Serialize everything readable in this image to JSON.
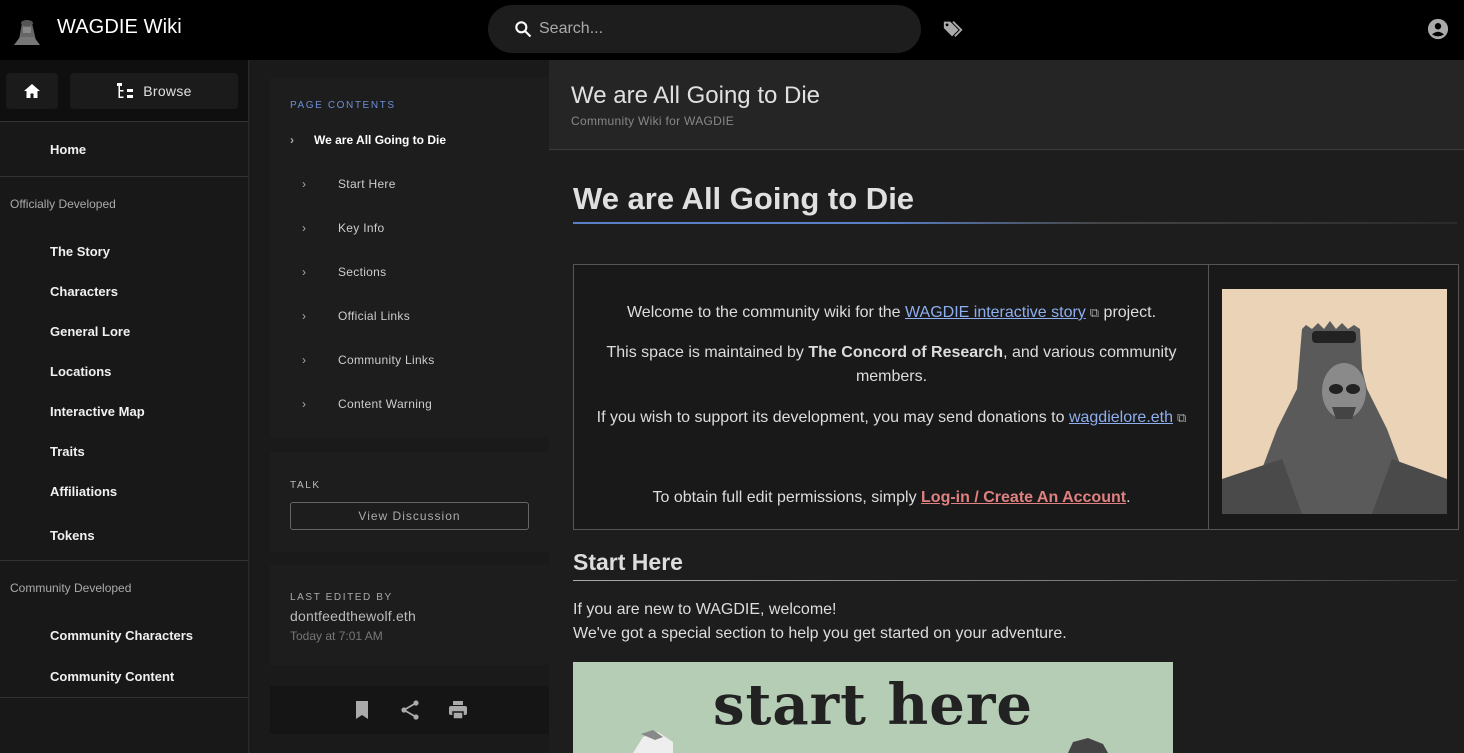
{
  "topbar": {
    "site_title": "WAGDIE Wiki",
    "search_placeholder": "Search...",
    "icons": [
      "logo",
      "search-icon",
      "tags-icon",
      "account-icon"
    ]
  },
  "leftnav": {
    "home_icon": "home-icon",
    "browse_label": "Browse",
    "home_item": "Home",
    "sections": [
      {
        "header": "Officially Developed",
        "items": [
          "The Story",
          "Characters",
          "General Lore",
          "Locations",
          "Interactive Map",
          "Traits",
          "Affiliations",
          "Tokens"
        ]
      },
      {
        "header": "Community Developed",
        "items": [
          "Community Characters",
          "Community Content"
        ]
      }
    ]
  },
  "toc": {
    "header": "PAGE CONTENTS",
    "top": "We are All Going to Die",
    "items": [
      "Start Here",
      "Key Info",
      "Sections",
      "Official Links",
      "Community Links",
      "Content Warning"
    ]
  },
  "talk": {
    "label": "TALK",
    "button": "View Discussion"
  },
  "last_edited": {
    "label": "LAST EDITED BY",
    "user": "dontfeedthewolf.eth",
    "time": "Today at 7:01 AM"
  },
  "actions": [
    "bookmark-icon",
    "share-icon",
    "print-icon"
  ],
  "page_header": {
    "title": "We are All Going to Die",
    "subtitle": "Community Wiki for WAGDIE"
  },
  "content": {
    "h1": "We are All Going to Die",
    "welcome": {
      "p1_before": "Welcome to the community wiki for the ",
      "p1_link": "WAGDIE interactive story",
      "p1_after": " project.",
      "p2_before": "This space is maintained by ",
      "p2_bold": "The Concord of Research",
      "p2_after": ", and various community members.",
      "p3_before": "If you wish to support its development, you may send donations to ",
      "p3_link": "wagdielore.eth",
      "p4_before": "To obtain full edit permissions, simply ",
      "p4_link": "Log-in / Create An Account",
      "p4_after": "."
    },
    "h2": "Start Here",
    "start_p1": "If you are new to WAGDIE, welcome!",
    "start_p2": "We've got a special section to help you get started on your adventure.",
    "banner_text": "start here"
  },
  "colors": {
    "accent": "#6b8fd6",
    "link": "#8eaef0",
    "login_link": "#e08080",
    "portrait_bg": "#ead3b6",
    "banner_bg": "#b5cdb5"
  }
}
